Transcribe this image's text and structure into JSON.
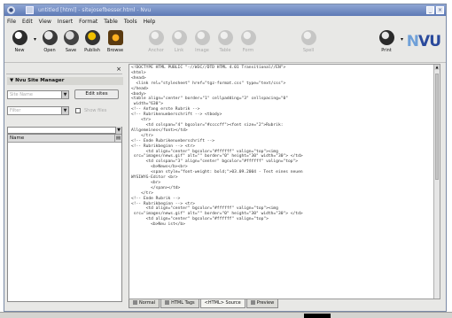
{
  "window": {
    "title": "untitled [html] - sitejosefbesser.html - Nvu",
    "colors": {
      "titlebar": "#5d79b5",
      "background": "#e8e8e6"
    }
  },
  "menu": [
    "File",
    "Edit",
    "View",
    "Insert",
    "Format",
    "Table",
    "Tools",
    "Help"
  ],
  "toolbar": {
    "buttons": [
      {
        "label": "New",
        "icon": "new-icon",
        "enabled": true
      },
      {
        "label": "Open",
        "icon": "open-icon",
        "enabled": true
      },
      {
        "label": "Save",
        "icon": "save-icon",
        "enabled": true
      },
      {
        "label": "Publish",
        "icon": "publish-icon",
        "enabled": true
      },
      {
        "label": "Browse",
        "icon": "browse-icon",
        "enabled": true
      },
      {
        "label": "Anchor",
        "icon": "anchor-icon",
        "enabled": false
      },
      {
        "label": "Link",
        "icon": "link-icon",
        "enabled": false
      },
      {
        "label": "Image",
        "icon": "image-icon",
        "enabled": false
      },
      {
        "label": "Table",
        "icon": "table-icon",
        "enabled": false
      },
      {
        "label": "Form",
        "icon": "form-icon",
        "enabled": false
      },
      {
        "label": "Spell",
        "icon": "spell-icon",
        "enabled": false
      },
      {
        "label": "Print",
        "icon": "print-icon",
        "enabled": true
      }
    ],
    "logo": "NVU"
  },
  "sidebar": {
    "title": "Nvu Site Manager",
    "site_select": "Site Name",
    "edit_sites": "Edit sites",
    "filter_select": "Filter",
    "checkbox_label": "Show files",
    "column_name": "Name"
  },
  "editor": {
    "lines": [
      "<!DOCTYPE HTML PUBLIC \"-//W3C//DTD HTML 4.01 Transitional//EN\">",
      "<html>",
      "<head>",
      "  <link rel=\"stylesheet\" href=\"tgz-format.css\" type=\"text/css\">",
      "</head>",
      "<body>",
      "<table align=\"center\" border=\"1\" cellpadding=\"3\" cellspacing=\"0\"",
      " width=\"630\">",
      "<!-- Anfang erste Rubrik -->",
      "<!-- Rubrikenueberschrift --> <tbody>",
      "    <tr>",
      "      <td colspan=\"4\" bgcolor=\"#ccccff\"><font size=\"2\">Rubrik:",
      "Allgemeines</font></td>",
      "    </tr>",
      "<!-- Ende Rubrikenueberschrift -->",
      "<!-- Rubrikbeginn --> <tr>",
      "      <td align=\"center\" bgcolor=\"#ffffff\" valign=\"top\"><img",
      " src=\"images/news.gif\" alt=\"\" border=\"0\" height=\"30\" width=\"30\"> </td>",
      "      <td colspan=\"3\" align=\"center\" bgcolor=\"#ffffff\" valign=\"top\">",
      "        <b>News</b><br>",
      "        <span style=\"font-weight: bold;\">03.09.2004 - Test eines neuen",
      "WYSIWYG-Editor <br>",
      "        <br>",
      "        </span></td>",
      "    </tr>",
      "<!-- Ende Rubrik -->",
      "<!-- Rubrikbeginn --> <tr>",
      "      <td align=\"center\" bgcolor=\"#ffffff\" valign=\"top\"><img",
      " src=\"images/news.gif\" alt=\"\" border=\"0\" height=\"30\" width=\"30\"> </td>",
      "      <td align=\"center\" bgcolor=\"#ffffff\" valign=\"top\">",
      "        <b>Neu ist</b>"
    ]
  },
  "tabs": [
    {
      "label": "Normal",
      "active": false
    },
    {
      "label": "HTML Tags",
      "active": false
    },
    {
      "label": "<HTML> Source",
      "active": true
    },
    {
      "label": "Preview",
      "active": false
    }
  ]
}
